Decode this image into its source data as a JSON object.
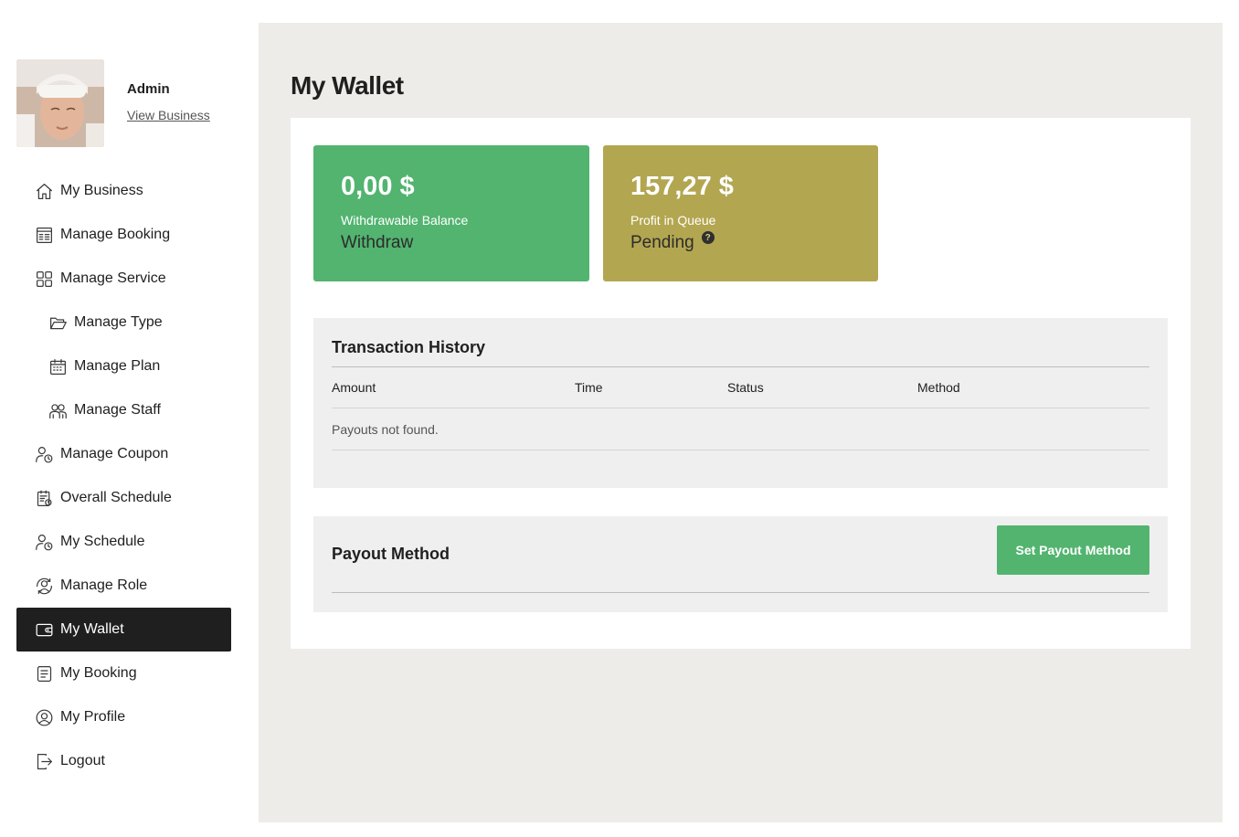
{
  "profile": {
    "name": "Admin",
    "link": "View Business"
  },
  "nav": [
    {
      "label": "My Business",
      "icon": "home-icon",
      "sub": false,
      "active": false
    },
    {
      "label": "Manage Booking",
      "icon": "booking-list-icon",
      "sub": false,
      "active": false
    },
    {
      "label": "Manage Service",
      "icon": "grid-icon",
      "sub": false,
      "active": false
    },
    {
      "label": "Manage Type",
      "icon": "folder-open-icon",
      "sub": true,
      "active": false
    },
    {
      "label": "Manage Plan",
      "icon": "calendar-icon",
      "sub": true,
      "active": false
    },
    {
      "label": "Manage Staff",
      "icon": "staff-icon",
      "sub": true,
      "active": false
    },
    {
      "label": "Manage Coupon",
      "icon": "user-clock-icon",
      "sub": false,
      "active": false
    },
    {
      "label": "Overall Schedule",
      "icon": "schedule-list-icon",
      "sub": false,
      "active": false
    },
    {
      "label": "My Schedule",
      "icon": "user-clock-icon",
      "sub": false,
      "active": false
    },
    {
      "label": "Manage Role",
      "icon": "role-icon",
      "sub": false,
      "active": false
    },
    {
      "label": "My Wallet",
      "icon": "wallet-icon",
      "sub": false,
      "active": true
    },
    {
      "label": "My Booking",
      "icon": "document-icon",
      "sub": false,
      "active": false
    },
    {
      "label": "My Profile",
      "icon": "user-circle-icon",
      "sub": false,
      "active": false
    },
    {
      "label": "Logout",
      "icon": "logout-icon",
      "sub": false,
      "active": false
    }
  ],
  "page": {
    "title": "My Wallet"
  },
  "cards": {
    "withdrawable": {
      "amount": "0,00 $",
      "label": "Withdrawable Balance",
      "action": "Withdraw",
      "color": "#52b46f"
    },
    "queue": {
      "amount": "157,27 $",
      "label": "Profit in Queue",
      "action": "Pending",
      "help": "?",
      "color": "#b3a650"
    }
  },
  "history": {
    "title": "Transaction History",
    "columns": [
      "Amount",
      "Time",
      "Status",
      "Method"
    ],
    "empty": "Payouts not found."
  },
  "payout": {
    "title": "Payout Method",
    "button": "Set Payout Method"
  }
}
